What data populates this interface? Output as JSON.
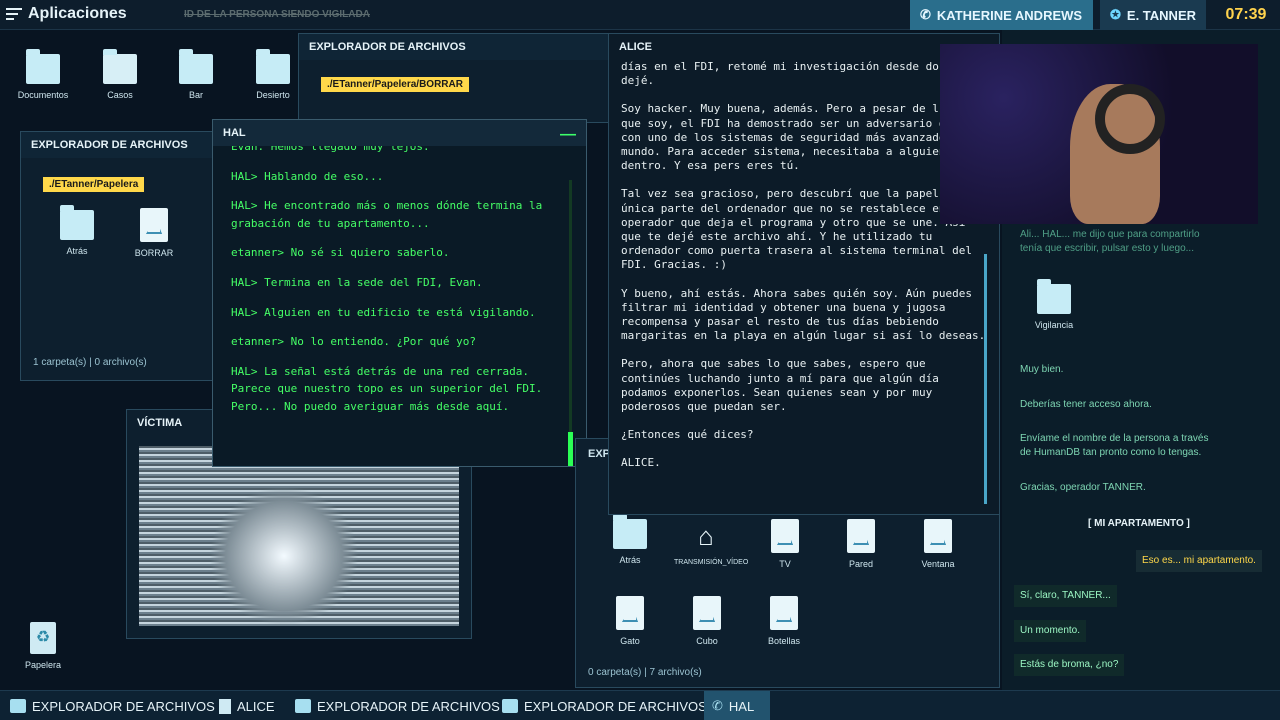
{
  "topbar": {
    "menu_label": "Aplicaciones",
    "tracking_text": "ID DE LA PERSONA SIENDO VIGILADA",
    "contact_name": "KATHERINE ANDREWS",
    "user_name": "E. TANNER",
    "time": "07:39"
  },
  "desktop_icons": [
    "Documentos",
    "Casos",
    "Bar",
    "Desierto",
    "Papelera"
  ],
  "explorer_main": {
    "title": "EXPLORADOR DE ARCHIVOS",
    "path": "./ETanner/Papelera/BORRAR"
  },
  "explorer_left": {
    "title": "EXPLORADOR DE ARCHIVOS",
    "path": "./ETanner/Papelera",
    "items": [
      "Atrás",
      "BORRAR"
    ],
    "status": "1 carpeta(s) | 0 archivo(s)"
  },
  "victim": {
    "title": "VÍCTIMA"
  },
  "hal": {
    "title": "HAL",
    "lines": [
      "Evan. Hemos llegado muy lejos.",
      "HAL> Hablando de eso...",
      "HAL> He encontrado más o menos dónde termina la grabación de tu apartamento...",
      "etanner> No sé si quiero saberlo.",
      "HAL> Termina en la sede del FDI, Evan.",
      "HAL> Alguien en tu edificio te está vigilando.",
      "etanner> No lo entiendo. ¿Por qué yo?",
      "HAL> La señal está detrás de una red cerrada. Parece que nuestro topo es un superior del FDI. Pero... No puedo averiguar más desde aquí."
    ]
  },
  "alice": {
    "title": "ALICE",
    "paragraphs": [
      "días en el FDI, retomé mi investigación desde do la dejé.",
      "Soy hacker. Muy buena, además. Pero a pesar de l buena que soy, el FDI ha demostrado ser un adversario digno, con uno de los sistemas de seguridad más avanzados del mundo. Para acceder sistema, necesitaba a alguien dentro. Y esa pers eres tú.",
      "Tal vez sea gracioso, pero descubrí que la papel es la única parte del ordenador que no se restablece entre un operador que deja el programa y otro que se une. Así que te dejé este archivo ahí. Y he utilizado tu ordenador como puerta trasera al sistema terminal del FDI. Gracias. :)",
      "Y bueno, ahí estás. Ahora sabes quién soy. Aún puedes filtrar mi identidad y obtener una buena y jugosa recompensa y pasar el resto de tus días bebiendo margaritas en la playa en algún lugar si así lo deseas.",
      "Pero, ahora que sabes lo que sabes, espero que continúes luchando junto a mí para que algún día podamos exponerlos. Sean quienes sean y por muy poderosos que puedan ser.",
      "¿Entonces qué dices?",
      "ALICE."
    ]
  },
  "explorer_bottom": {
    "title_partial": "EXP",
    "items": [
      "Atrás",
      "TRANSMISIÓN_VÍDEO",
      "TV",
      "Pared",
      "Ventana",
      "Gato",
      "Cubo",
      "Botellas"
    ],
    "status": "0 carpeta(s) | 7 archivo(s)"
  },
  "chat": {
    "header_partial": "Ali... HAL... me dijo que para compartirlo tenía que escribir, pulsar esto y luego...",
    "folder": "Vigilancia",
    "messages": [
      "Muy bien.",
      "Deberías tener acceso ahora.",
      "Envíame el nombre de la persona a través de HumanDB tan pronto como lo tengas.",
      "Gracias, operador TANNER."
    ],
    "link": "[ MI APARTAMENTO ]",
    "me": "Eso es... mi apartamento.",
    "replies": [
      "Sí, claro, TANNER...",
      "Un momento.",
      "Estás de broma, ¿no?"
    ]
  },
  "taskbar": [
    "EXPLORADOR DE ARCHIVOS",
    "ALICE",
    "EXPLORADOR DE ARCHIVOS",
    "EXPLORADOR DE ARCHIVOS",
    "HAL"
  ]
}
